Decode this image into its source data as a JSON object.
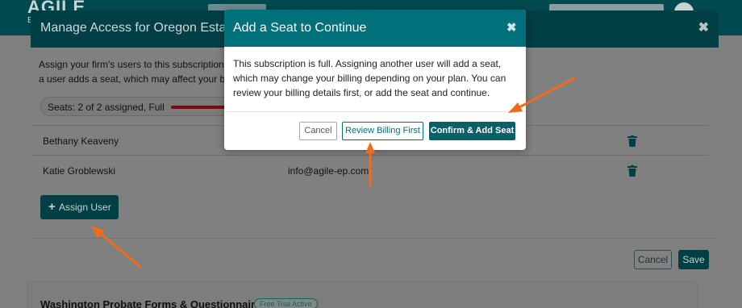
{
  "background": {
    "logo": "AGILE",
    "logo_sub": "E",
    "card_title": "Washington Probate Forms & Questionnaires",
    "card_badge": "Free Trial Active"
  },
  "manage_modal": {
    "title": "Manage Access for Oregon Estate",
    "heading_frag": "M",
    "u_frag": "U",
    "s_frag": "S",
    "desc_line1": "Assign your firm's users to this subscription",
    "desc_line2": "a user adds a seat, which may affect your b",
    "seats_label": "Seats:  2 of 2 assigned, Full",
    "users": [
      {
        "name": "Bethany Keaveny",
        "email": ""
      },
      {
        "name": "Katie Groblewski",
        "email": "info@agile-ep.com"
      }
    ],
    "assign_button": "Assign User",
    "cancel_button": "Cancel",
    "save_button": "Save",
    "close_glyph": "✖"
  },
  "seat_modal": {
    "title": "Add a Seat to Continue",
    "close_glyph": "✖",
    "body_line1": "This subscription is full. Assigning another user will add a seat,",
    "body_line2": "which may change your billing depending on your plan. You can",
    "body_line3": "review your billing details first, or add the seat and continue.",
    "cancel_button": "Cancel",
    "review_button": "Review Billing First",
    "confirm_button": "Confirm & Add Seat"
  },
  "colors": {
    "header_teal": "#00707a",
    "primary_button": "#0b5f66",
    "arrow_orange": "#f26b1d",
    "seats_bar_red": "#7a0a12"
  },
  "icons": {
    "trash": "trash-icon",
    "plus": "plus-icon",
    "close": "close-icon"
  }
}
